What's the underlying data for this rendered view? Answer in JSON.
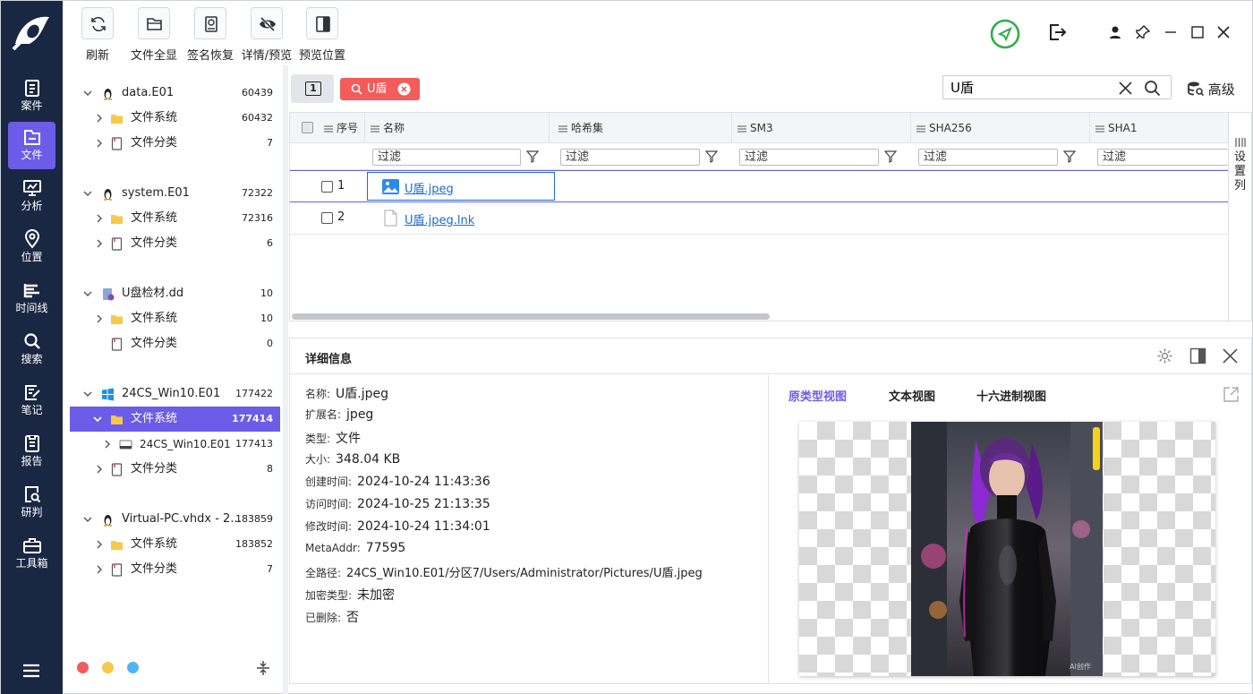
{
  "rail": {
    "items": [
      {
        "label": "案件",
        "icon": "clipboard-icon"
      },
      {
        "label": "文件",
        "icon": "folder-file-icon"
      },
      {
        "label": "分析",
        "icon": "monitor-chart-icon"
      },
      {
        "label": "位置",
        "icon": "location-pin-icon"
      },
      {
        "label": "时间线",
        "icon": "timeline-icon"
      },
      {
        "label": "搜索",
        "icon": "search-icon"
      },
      {
        "label": "笔记",
        "icon": "note-edit-icon"
      },
      {
        "label": "报告",
        "icon": "report-icon"
      },
      {
        "label": "研判",
        "icon": "analyze-doc-icon"
      },
      {
        "label": "工具箱",
        "icon": "toolbox-icon"
      }
    ],
    "active": "文件"
  },
  "toolbar": {
    "buttons": [
      {
        "label": "刷新",
        "icon": "refresh-icon"
      },
      {
        "label": "文件全显",
        "icon": "folder-open-icon"
      },
      {
        "label": "签名恢复",
        "icon": "disk-restore-icon"
      },
      {
        "label": "详情/预览",
        "icon": "eye-off-icon"
      },
      {
        "label": "预览位置",
        "icon": "panel-right-icon"
      }
    ]
  },
  "tree": {
    "nodes": [
      {
        "label": "data.E01",
        "count": "60439",
        "icon": "linux-icon"
      },
      {
        "label": "文件系统",
        "count": "60432",
        "icon": "folder-icon"
      },
      {
        "label": "文件分类",
        "count": "7",
        "icon": "file-category-icon"
      },
      {
        "label": "system.E01",
        "count": "72322",
        "icon": "linux-icon"
      },
      {
        "label": "文件系统",
        "count": "72316",
        "icon": "folder-icon"
      },
      {
        "label": "文件分类",
        "count": "6",
        "icon": "file-category-icon"
      },
      {
        "label": "U盘检材.dd",
        "count": "10",
        "icon": "disk-image-icon"
      },
      {
        "label": "文件系统",
        "count": "10",
        "icon": "folder-icon"
      },
      {
        "label": "文件分类",
        "count": "0",
        "icon": "file-category-icon"
      },
      {
        "label": "24CS_Win10.E01",
        "count": "177422",
        "icon": "windows-icon"
      },
      {
        "label": "文件系统",
        "count": "177414",
        "icon": "folder-icon"
      },
      {
        "label": "24CS_Win10.E01",
        "count": "177413",
        "icon": "drive-icon"
      },
      {
        "label": "文件分类",
        "count": "8",
        "icon": "file-category-icon"
      },
      {
        "label": "Virtual-PC.vhdx - 2...",
        "count": "183859",
        "icon": "linux-icon"
      },
      {
        "label": "文件系统",
        "count": "183852",
        "icon": "folder-icon"
      },
      {
        "label": "文件分类",
        "count": "7",
        "icon": "file-category-icon"
      }
    ],
    "selected": "文件系统 177414",
    "dots": [
      "#f25c5c",
      "#f7c948",
      "#4fb6f5"
    ]
  },
  "filter": {
    "page_indicator": "1",
    "chip_label": "U盾",
    "search_value": "U盾",
    "advanced_label": "高级"
  },
  "table": {
    "columns": [
      "序号",
      "名称",
      "哈希集",
      "SM3",
      "SHA256",
      "SHA1"
    ],
    "filter_placeholder": "过滤",
    "rows": [
      {
        "index": "1",
        "name": "U盾.jpeg",
        "icon": "image-file-icon"
      },
      {
        "index": "2",
        "name": "U盾.jpeg.lnk",
        "icon": "blank-file-icon"
      }
    ],
    "settings_label": "设置列"
  },
  "details": {
    "title": "详细信息",
    "props": [
      {
        "key": "名称:",
        "value": "U盾.jpeg"
      },
      {
        "key": "扩展名:",
        "value": "jpeg"
      },
      {
        "key": "类型:",
        "value": "文件"
      },
      {
        "key": "大小:",
        "value": "348.04 KB"
      },
      {
        "key": "创建时间:",
        "value": "2024-10-24 11:43:36"
      },
      {
        "key": "访问时间:",
        "value": "2024-10-25 21:13:35"
      },
      {
        "key": "修改时间:",
        "value": "2024-10-24 11:34:01"
      },
      {
        "key": "MetaAddr:",
        "value": "77595"
      },
      {
        "key": "全路径:",
        "value": "24CS_Win10.E01/分区7/Users/Administrator/Pictures/U盾.jpeg"
      },
      {
        "key": "加密类型:",
        "value": "未加密"
      },
      {
        "key": "已删除:",
        "value": "否"
      }
    ],
    "tabs": [
      "原类型视图",
      "文本视图",
      "十六进制视图"
    ],
    "active_tab": "原类型视图",
    "watermark": "AI创作"
  },
  "colors": {
    "accent": "#6c5ce7",
    "rail": "#1a2743",
    "chip": "#f45b5b",
    "link": "#1c6ad6"
  }
}
